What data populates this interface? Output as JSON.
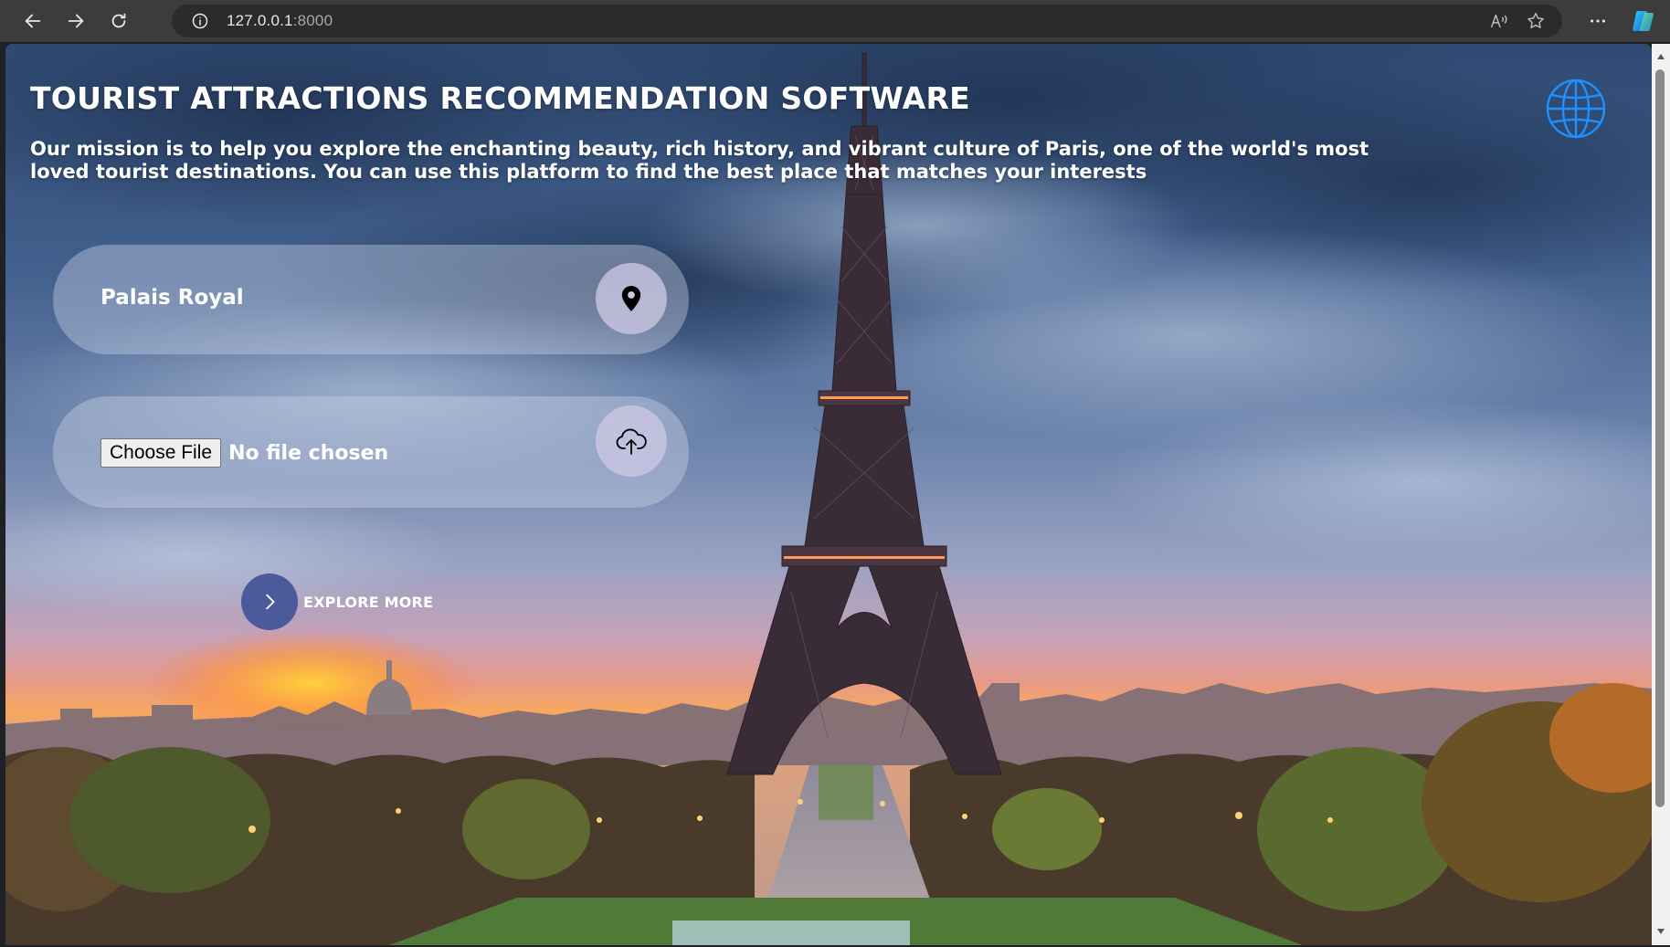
{
  "browser": {
    "url_host": "127.0.0.1",
    "url_port": ":8000"
  },
  "page": {
    "title": "TOURIST ATTRACTIONS RECOMMENDATION SOFTWARE",
    "mission": "Our mission is to help you explore the enchanting beauty, rich history, and vibrant culture of Paris, one of the world's most loved tourist destinations. You can use this platform to find the best place that matches your interests"
  },
  "location_search": {
    "value": "Palais Royal"
  },
  "upload": {
    "button_label": "Choose File",
    "status": "No file chosen"
  },
  "explore": {
    "label": "EXPLORE MORE"
  },
  "colors": {
    "accent_button": "#4a5a9a",
    "globe": "#1e90ff",
    "pill_icon_bg": "#cdc8e4"
  },
  "icons": {
    "back": "arrow-left-icon",
    "forward": "arrow-right-icon",
    "reload": "reload-icon",
    "info": "info-icon",
    "read_aloud": "read-aloud-icon",
    "favorite": "star-icon",
    "more": "more-icon",
    "copilot": "copilot-icon",
    "globe": "globe-icon",
    "location": "location-pin-icon",
    "upload": "cloud-upload-icon",
    "explore": "chevron-right-icon"
  }
}
